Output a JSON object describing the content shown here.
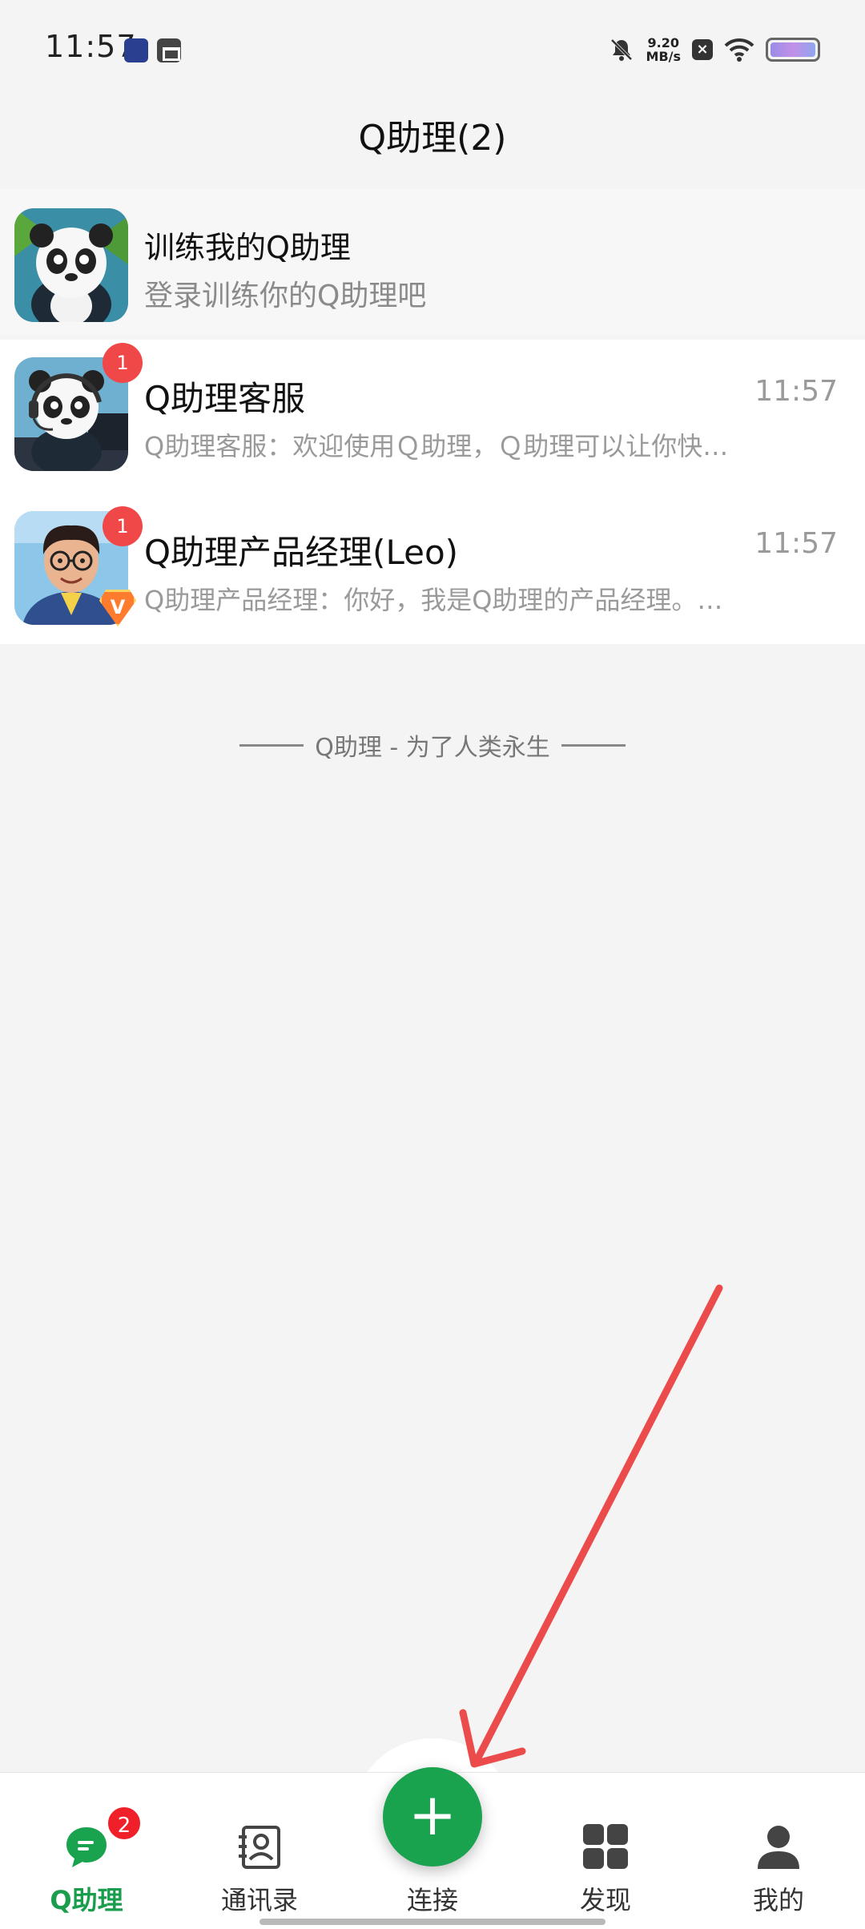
{
  "status_bar": {
    "time": "11:57",
    "net_speed_value": "9.20",
    "net_speed_unit": "MB/s"
  },
  "header": {
    "title": "Q助理(2)"
  },
  "chats": [
    {
      "name": "训练我的Q助理",
      "preview": "登录训练你的Q助理吧",
      "time": "",
      "unread": "",
      "pinned": true
    },
    {
      "name": "Q助理客服",
      "preview": "Q助理客服：欢迎使用Ｑ助理，Ｑ助理可以让你快…",
      "time": "11:57",
      "unread": "1"
    },
    {
      "name": "Q助理产品经理(Leo)",
      "preview": "Q助理产品经理：你好，我是Q助理的产品经理。…",
      "time": "11:57",
      "unread": "1",
      "vip_label": "V"
    }
  ],
  "footer_slogan": "Q助理 - 为了人类永生",
  "bottom_nav": {
    "items": [
      {
        "label": "Q助理",
        "icon": "chat-bubble-icon",
        "badge": "2",
        "active": true
      },
      {
        "label": "通讯录",
        "icon": "contacts-icon"
      },
      {
        "label": "连接",
        "icon": "plus-icon"
      },
      {
        "label": "发现",
        "icon": "grid-icon"
      },
      {
        "label": "我的",
        "icon": "person-icon"
      }
    ],
    "connect_symbol": "+"
  },
  "colors": {
    "accent_green": "#1aa34f",
    "badge_red": "#f04848",
    "annotation_arrow": "#ec4b4b"
  }
}
